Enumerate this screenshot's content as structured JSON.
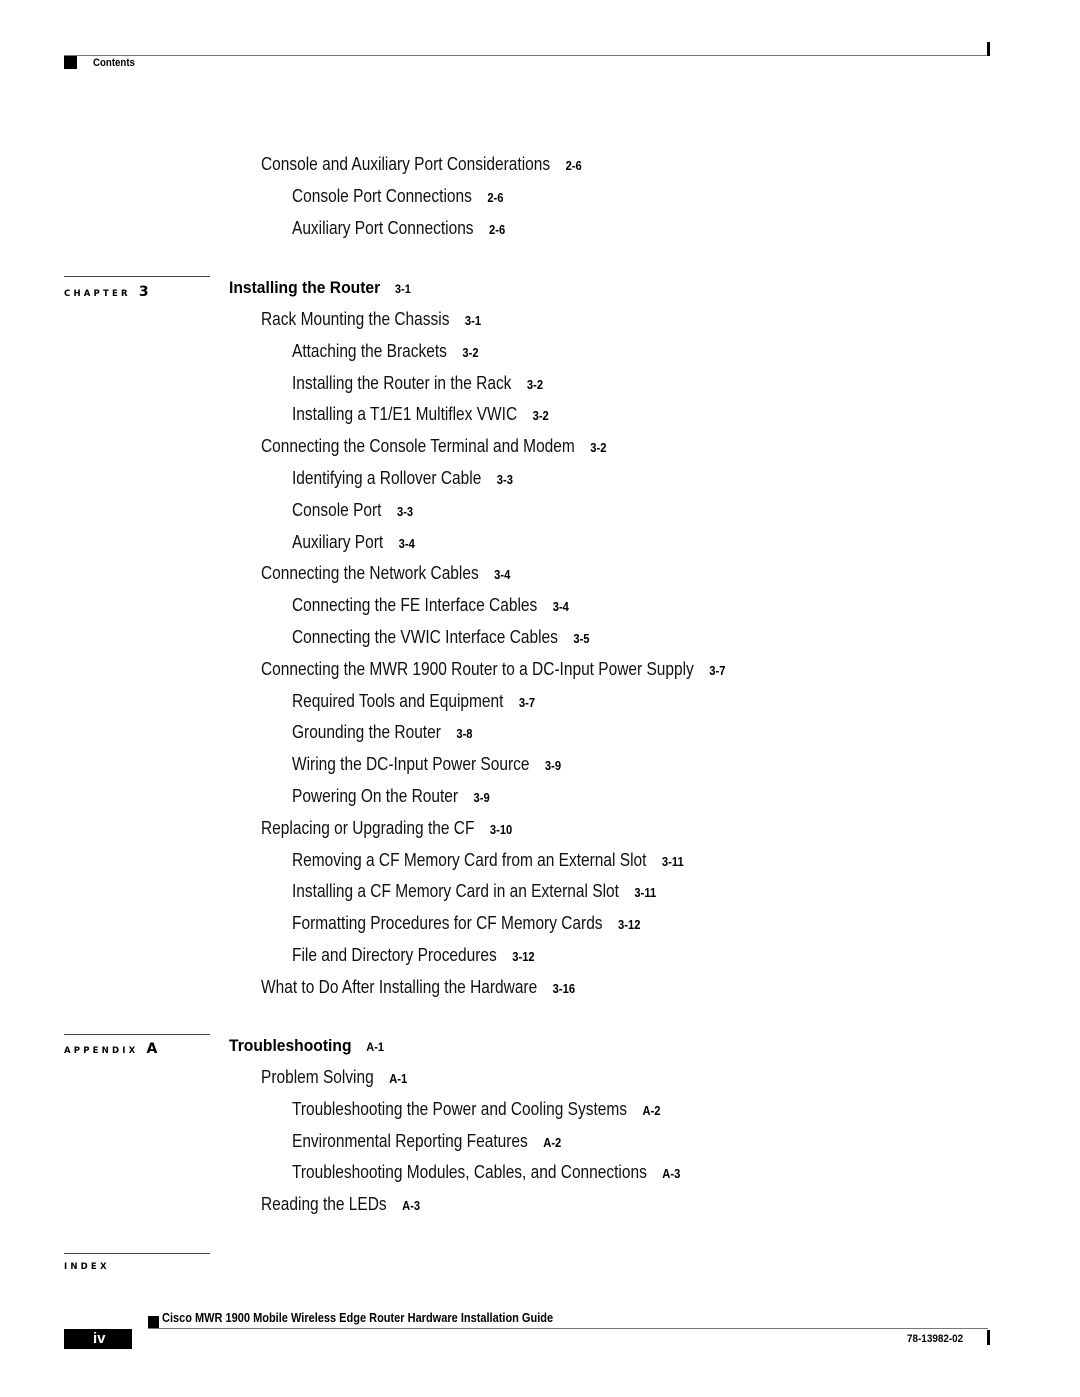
{
  "header": {
    "label": "Contents"
  },
  "top_entries": [
    {
      "title": "Console and Auxiliary Port Considerations",
      "page": "2-6",
      "level": 1
    },
    {
      "title": "Console Port Connections",
      "page": "2-6",
      "level": 2
    },
    {
      "title": "Auxiliary Port Connections",
      "page": "2-6",
      "level": 2
    }
  ],
  "chapter3": {
    "label": "CHAPTER",
    "number": "3",
    "title": "Installing the Router",
    "page": "3-1",
    "entries": [
      {
        "title": "Rack Mounting the Chassis",
        "page": "3-1",
        "level": 1
      },
      {
        "title": "Attaching the Brackets",
        "page": "3-2",
        "level": 2
      },
      {
        "title": "Installing the Router in the Rack",
        "page": "3-2",
        "level": 2
      },
      {
        "title": "Installing a T1/E1 Multiflex VWIC",
        "page": "3-2",
        "level": 2
      },
      {
        "title": "Connecting the Console Terminal and Modem",
        "page": "3-2",
        "level": 1
      },
      {
        "title": "Identifying a Rollover Cable",
        "page": "3-3",
        "level": 2
      },
      {
        "title": "Console Port",
        "page": "3-3",
        "level": 2
      },
      {
        "title": "Auxiliary Port",
        "page": "3-4",
        "level": 2
      },
      {
        "title": "Connecting the Network Cables",
        "page": "3-4",
        "level": 1
      },
      {
        "title": "Connecting the FE Interface Cables",
        "page": "3-4",
        "level": 2
      },
      {
        "title": "Connecting the VWIC Interface Cables",
        "page": "3-5",
        "level": 2
      },
      {
        "title": "Connecting the MWR 1900 Router to a DC-Input Power Supply",
        "page": "3-7",
        "level": 1
      },
      {
        "title": "Required Tools and Equipment",
        "page": "3-7",
        "level": 2
      },
      {
        "title": "Grounding the Router",
        "page": "3-8",
        "level": 2
      },
      {
        "title": "Wiring the DC-Input Power Source",
        "page": "3-9",
        "level": 2
      },
      {
        "title": "Powering On the Router",
        "page": "3-9",
        "level": 2
      },
      {
        "title": "Replacing or Upgrading the CF",
        "page": "3-10",
        "level": 1
      },
      {
        "title": "Removing a CF Memory Card from an External Slot",
        "page": "3-11",
        "level": 2
      },
      {
        "title": "Installing a CF Memory Card in an External Slot",
        "page": "3-11",
        "level": 2
      },
      {
        "title": "Formatting Procedures for CF Memory Cards",
        "page": "3-12",
        "level": 2
      },
      {
        "title": "File and Directory Procedures",
        "page": "3-12",
        "level": 2
      },
      {
        "title": "What to Do After Installing the Hardware",
        "page": "3-16",
        "level": 1
      }
    ]
  },
  "appendixA": {
    "label": "APPENDIX",
    "number": "A",
    "title": "Troubleshooting",
    "page": "A-1",
    "entries": [
      {
        "title": "Problem Solving",
        "page": "A-1",
        "level": 1
      },
      {
        "title": "Troubleshooting the Power and Cooling Systems",
        "page": "A-2",
        "level": 2
      },
      {
        "title": "Environmental Reporting Features",
        "page": "A-2",
        "level": 2
      },
      {
        "title": "Troubleshooting Modules, Cables, and Connections",
        "page": "A-3",
        "level": 2
      },
      {
        "title": "Reading the LEDs",
        "page": "A-3",
        "level": 1
      }
    ]
  },
  "index": {
    "label": "INDEX"
  },
  "footer": {
    "guide_title": "Cisco MWR 1900 Mobile Wireless Edge Router Hardware Installation Guide",
    "page_number": "iv",
    "doc_number": "78-13982-02"
  }
}
